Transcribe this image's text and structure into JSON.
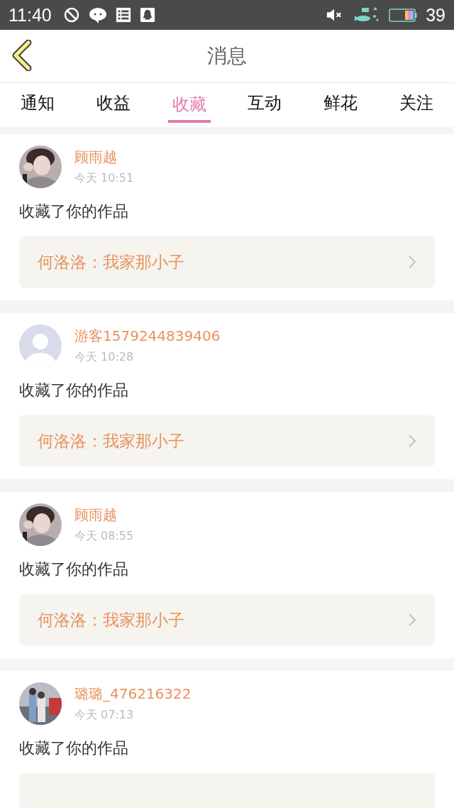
{
  "status_bar": {
    "time": "11:40",
    "battery": "39"
  },
  "header": {
    "title": "消息"
  },
  "tabs": [
    {
      "label": "通知",
      "selected": false
    },
    {
      "label": "收益",
      "selected": false
    },
    {
      "label": "收藏",
      "selected": true
    },
    {
      "label": "互动",
      "selected": false
    },
    {
      "label": "鲜花",
      "selected": false
    },
    {
      "label": "关注",
      "selected": false
    }
  ],
  "messages": [
    {
      "user": "顾雨越",
      "time": "今天 10:51",
      "action": "收藏了你的作品",
      "work": "何洛洛：我家那小子"
    },
    {
      "kind": "default",
      "user": "游客1579244839406",
      "time": "今天 10:28",
      "action": "收藏了你的作品",
      "work": "何洛洛：我家那小子"
    },
    {
      "user": "顾雨越",
      "time": "今天 08:55",
      "action": "收藏了你的作品",
      "work": "何洛洛：我家那小子"
    },
    {
      "kind": "street",
      "user": "璐璐_476216322",
      "time": "今天 07:13",
      "action": "收藏了你的作品",
      "work_cut": true
    }
  ]
}
